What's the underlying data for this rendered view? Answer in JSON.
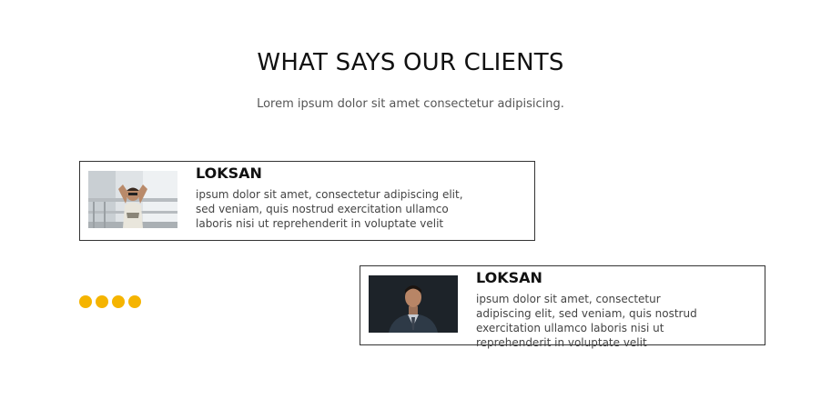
{
  "section": {
    "title": "WHAT SAYS OUR CLIENTS",
    "subtitle": "Lorem ipsum dolor sit amet consectetur adipisicing."
  },
  "testimonials": [
    {
      "name": "LOKSAN",
      "quote": "ipsum dolor sit amet, consectetur adipiscing elit, sed veniam, quis nostrud exercitation ullamco laboris nisi ut reprehenderit in voluptate velit",
      "photo": "man-posing-outdoor-photo"
    },
    {
      "name": "LOKSAN",
      "quote": "ipsum dolor sit amet, consectetur adipiscing elit, sed veniam, quis nostrud exercitation ullamco laboris nisi ut reprehenderit in voluptate velit",
      "photo": "man-in-suit-portrait-photo"
    }
  ],
  "carousel": {
    "dot_color": "#f5b400",
    "dots": [
      "dot-1",
      "dot-2",
      "dot-3",
      "dot-4"
    ]
  }
}
